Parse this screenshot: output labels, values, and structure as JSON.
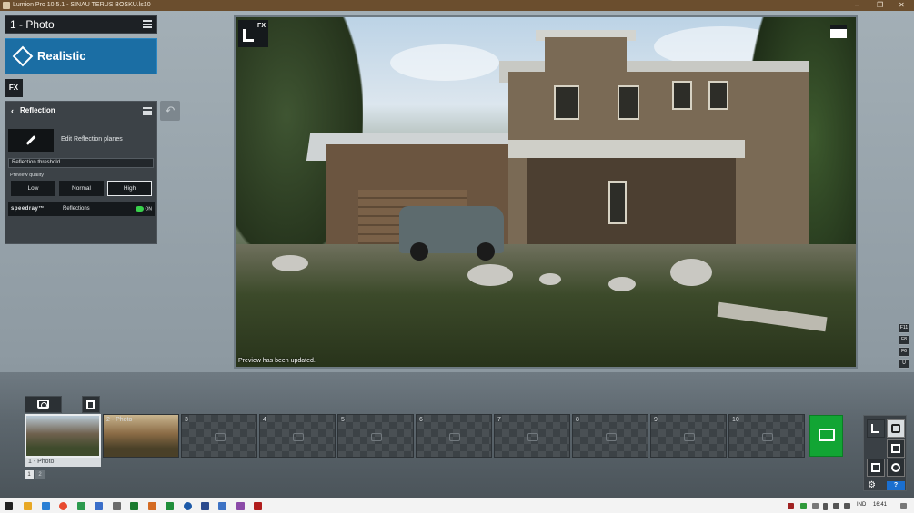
{
  "window": {
    "title": "Lumion Pro 10.5.1 - SINAU TERUS BOSKU.ls10"
  },
  "photo_header": {
    "title": "1 - Photo"
  },
  "style_button": {
    "label": "Realistic"
  },
  "fx_button": {
    "label": "FX"
  },
  "effect_panel": {
    "title": "Reflection",
    "edit_planes_label": "Edit Reflection planes",
    "threshold_label": "Reflection threshold",
    "preview_quality_label": "Preview quality",
    "quality_options": [
      "Low",
      "Normal",
      "High"
    ],
    "selected_quality": "High",
    "speedray_brand": "speedray™",
    "speedray_label": "Reflections",
    "toggle_state": "ON",
    "toggle_color": "#38d14b"
  },
  "viewport": {
    "fx_badge": "FX",
    "status": "Preview has been updated."
  },
  "function_keys": [
    "F11",
    "F8",
    "F6",
    "U"
  ],
  "filmstrip": {
    "slots": [
      {
        "number": "",
        "filled": true
      },
      {
        "number": "2 - Photo",
        "filled": true
      },
      {
        "number": "3",
        "filled": false
      },
      {
        "number": "4",
        "filled": false
      },
      {
        "number": "5",
        "filled": false
      },
      {
        "number": "6",
        "filled": false
      },
      {
        "number": "7",
        "filled": false
      },
      {
        "number": "8",
        "filled": false
      },
      {
        "number": "9",
        "filled": false
      },
      {
        "number": "10",
        "filled": false
      }
    ],
    "selected_caption": "1 - Photo",
    "pages": [
      "1",
      "2"
    ],
    "render_button_color": "#12a534"
  },
  "mode_box": {
    "help": "?"
  },
  "taskbar": {
    "language": "IND",
    "time": "16:41"
  },
  "colors": {
    "accent_blue": "#1b6ea4",
    "panel_dark": "#3c4247"
  }
}
